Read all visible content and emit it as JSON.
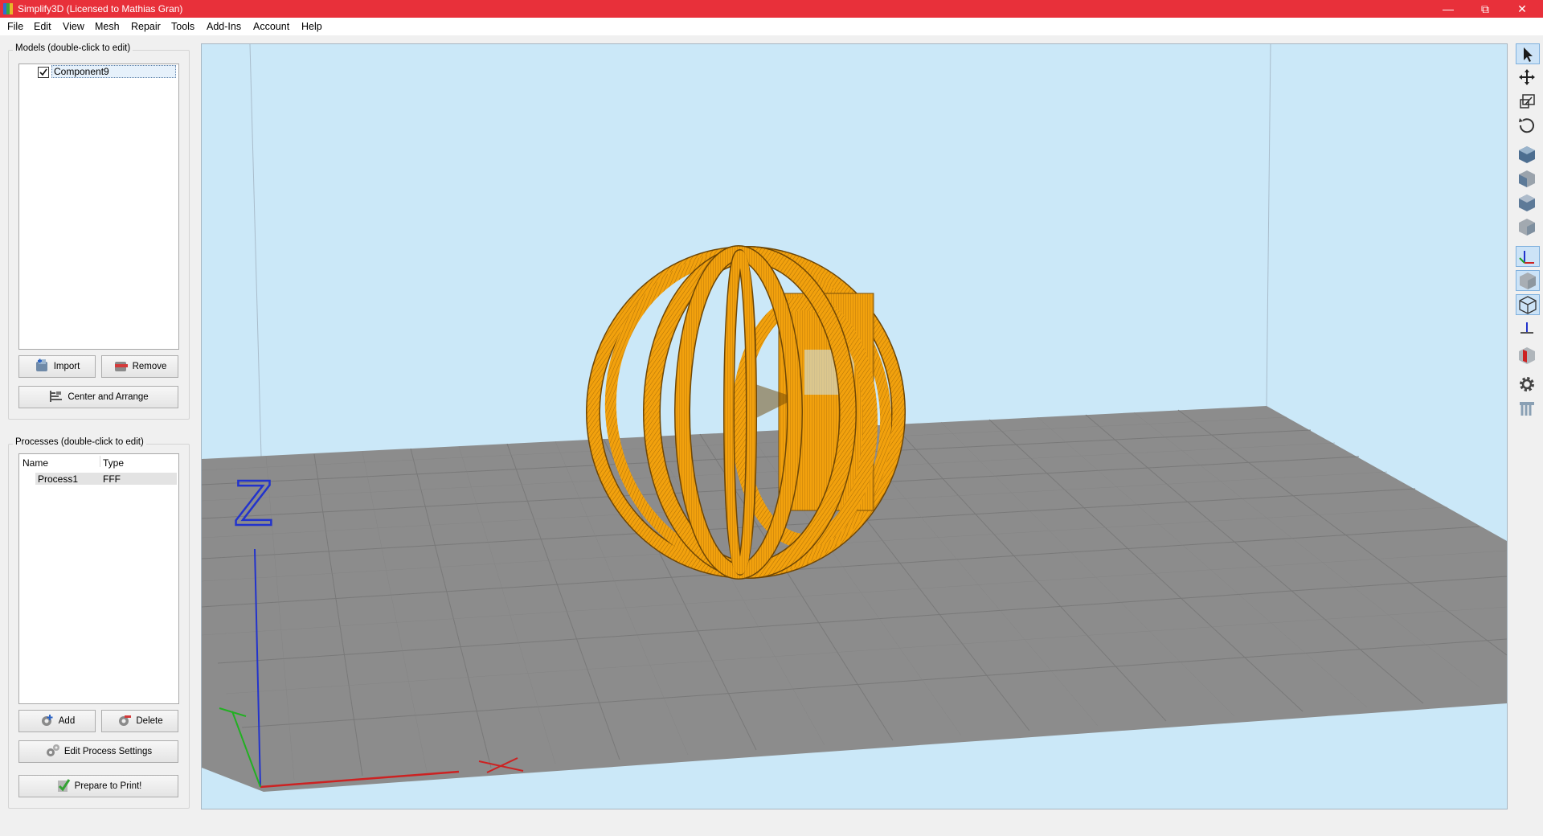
{
  "window": {
    "title": "Simplify3D (Licensed to Mathias Gran)",
    "title_bar_color": "#e8303a",
    "controls": [
      "minimize-icon",
      "restore-icon",
      "close-icon"
    ]
  },
  "menu": [
    "File",
    "Edit",
    "View",
    "Mesh",
    "Repair",
    "Tools",
    "Add-Ins",
    "Account",
    "Help"
  ],
  "models": {
    "title": "Models (double-click to edit)",
    "items": [
      {
        "label": "Component9",
        "checked": true
      }
    ],
    "import_label": "Import",
    "remove_label": "Remove",
    "center_label": "Center and Arrange"
  },
  "processes": {
    "title": "Processes (double-click to edit)",
    "columns": [
      "Name",
      "Type"
    ],
    "rows": [
      {
        "name": "Process1",
        "type": "FFF"
      }
    ],
    "add_label": "Add",
    "delete_label": "Delete",
    "edit_label": "Edit Process Settings",
    "prepare_label": "Prepare to Print!"
  },
  "viewport": {
    "axis_label": "Z",
    "model_color": "#f2a10d",
    "bed_color": "#8c8c8c",
    "background_color": "#cbe8f8"
  },
  "toolbar": [
    "select-arrow-icon",
    "move-icon",
    "scale-icon",
    "rotate-icon",
    "view-iso-icon",
    "view-front-icon",
    "view-top-icon",
    "view-side-icon",
    "axes-toggle-icon",
    "solid-view-icon",
    "wireframe-view-icon",
    "axes-small-icon",
    "cross-section-icon",
    "settings-gear-icon",
    "supports-icon"
  ]
}
